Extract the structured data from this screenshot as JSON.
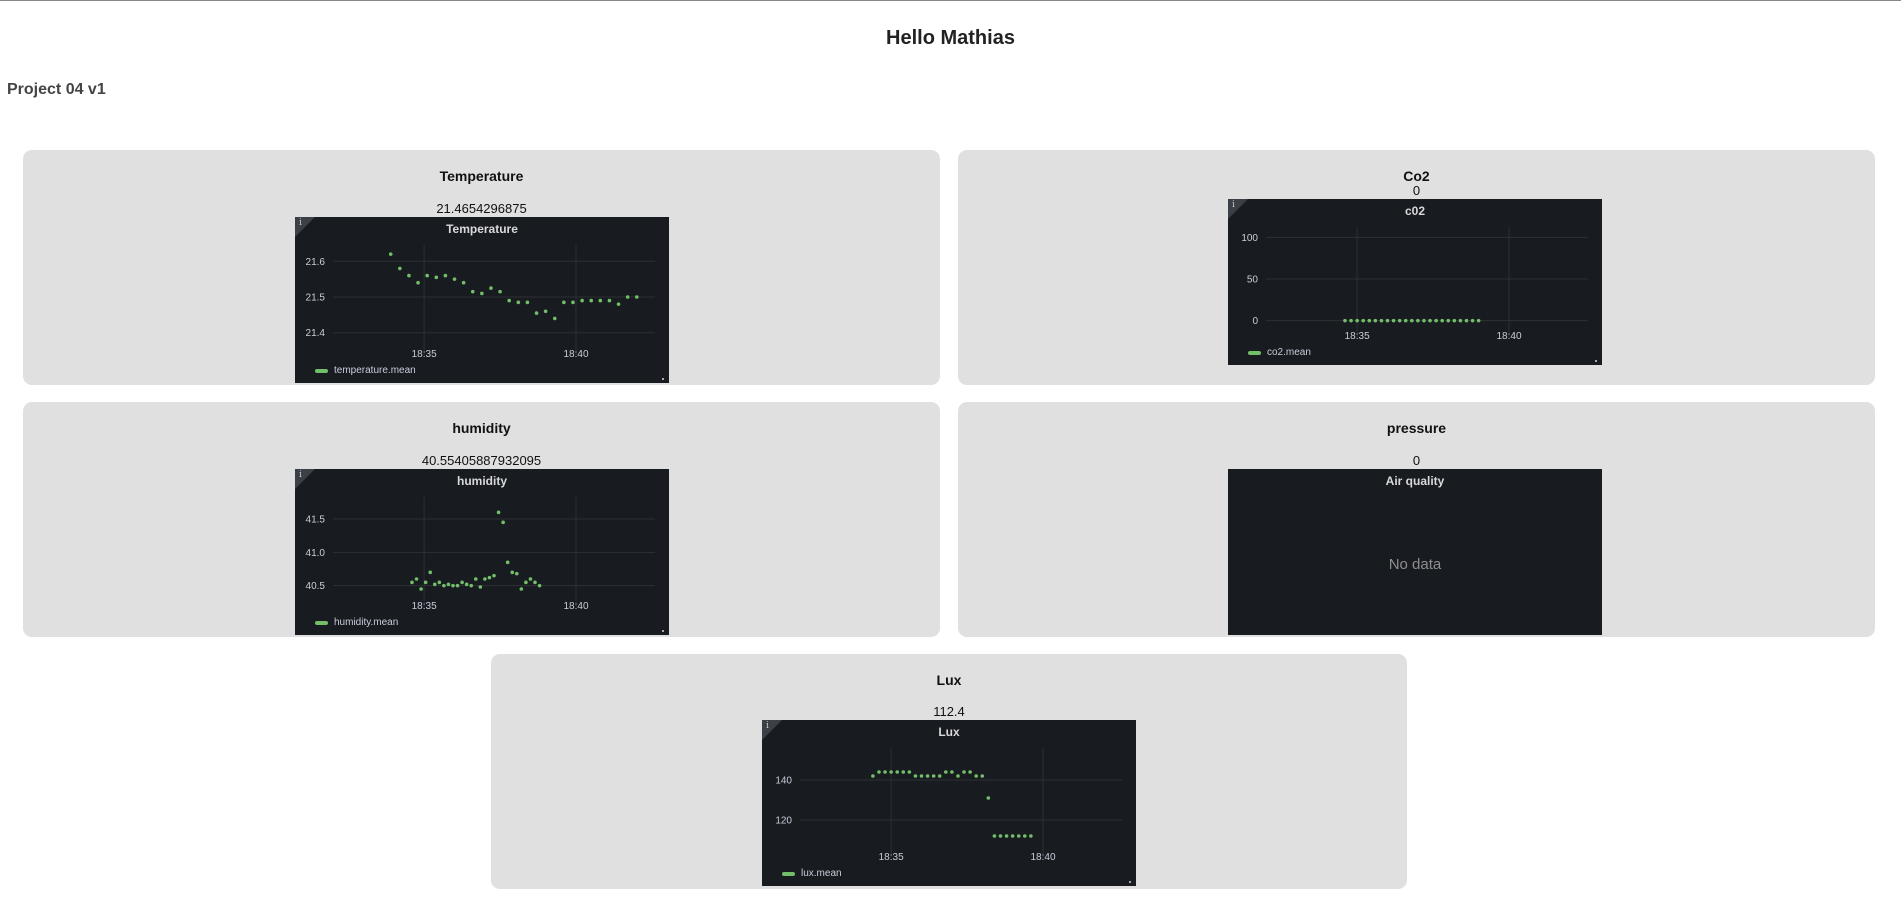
{
  "page": {
    "greeting": "Hello Mathias",
    "project": "Project 04 v1"
  },
  "colors": {
    "card_bg": "#e0e0e0",
    "panel_bg": "#181b1f",
    "series_green": "#73bf69",
    "grid": "#2c3036",
    "text_light": "#ccccdc"
  },
  "cards": {
    "temperature": {
      "title": "Temperature",
      "value": "21.4654296875",
      "panel_title": "Temperature",
      "legend": "temperature.mean",
      "info_icon": "info-icon"
    },
    "co2": {
      "title": "Co2",
      "value": "0",
      "panel_title": "c02",
      "legend": "co2.mean",
      "info_icon": "info-icon"
    },
    "humidity": {
      "title": "humidity",
      "value": "40.55405887932095",
      "panel_title": "humidity",
      "legend": "humidity.mean",
      "info_icon": "info-icon"
    },
    "pressure": {
      "title": "pressure",
      "value": "0",
      "panel_title": "Air quality",
      "no_data": "No data"
    },
    "lux": {
      "title": "Lux",
      "value": "112.4",
      "panel_title": "Lux",
      "legend": "lux.mean",
      "info_icon": "info-icon"
    }
  },
  "chart_data": [
    {
      "id": "temperature",
      "type": "scatter",
      "title": "Temperature",
      "series": [
        {
          "name": "temperature.mean",
          "x": [
            33.9,
            34.2,
            34.5,
            34.8,
            35.1,
            35.4,
            35.7,
            36.0,
            36.3,
            36.6,
            36.9,
            37.2,
            37.5,
            37.8,
            38.1,
            38.4,
            38.7,
            39.0,
            39.3,
            39.6,
            39.9,
            40.2,
            40.5,
            40.8,
            41.1,
            41.4,
            41.7,
            42.0
          ],
          "values": [
            21.62,
            21.58,
            21.56,
            21.54,
            21.56,
            21.555,
            21.56,
            21.55,
            21.54,
            21.515,
            21.51,
            21.525,
            21.515,
            21.49,
            21.485,
            21.485,
            21.455,
            21.46,
            21.44,
            21.485,
            21.485,
            21.49,
            21.49,
            21.49,
            21.49,
            21.48,
            21.5,
            21.5
          ]
        }
      ],
      "x_ticks": [
        "18:35",
        "18:40"
      ],
      "y_ticks": [
        "21.4",
        "21.5",
        "21.6"
      ],
      "ylim": [
        21.36,
        21.64
      ]
    },
    {
      "id": "co2",
      "type": "scatter",
      "title": "c02",
      "series": [
        {
          "name": "co2.mean",
          "x": [
            34.6,
            34.8,
            35.0,
            35.2,
            35.4,
            35.6,
            35.8,
            36.0,
            36.2,
            36.4,
            36.6,
            36.8,
            37.0,
            37.2,
            37.4,
            37.6,
            37.8,
            38.0,
            38.2,
            38.4,
            38.6,
            38.8,
            39.0
          ],
          "values": [
            0,
            0,
            0,
            0,
            0,
            0,
            0,
            0,
            0,
            0,
            0,
            0,
            0,
            0,
            0,
            0,
            0,
            0,
            0,
            0,
            0,
            0,
            0
          ]
        }
      ],
      "x_ticks": [
        "18:35",
        "18:40"
      ],
      "y_ticks": [
        "0",
        "50",
        "100"
      ],
      "ylim": [
        -10,
        110
      ]
    },
    {
      "id": "humidity",
      "type": "scatter",
      "title": "humidity",
      "series": [
        {
          "name": "humidity.mean",
          "x": [
            34.6,
            34.75,
            34.9,
            35.05,
            35.2,
            35.35,
            35.5,
            35.65,
            35.8,
            35.95,
            36.1,
            36.25,
            36.4,
            36.55,
            36.7,
            36.85,
            37.0,
            37.15,
            37.3,
            37.45,
            37.6,
            37.75,
            37.9,
            38.05,
            38.2,
            38.35,
            38.5,
            38.65,
            38.8
          ],
          "values": [
            40.55,
            40.6,
            40.45,
            40.55,
            40.7,
            40.52,
            40.55,
            40.5,
            40.52,
            40.5,
            40.5,
            40.55,
            40.52,
            40.5,
            40.6,
            40.48,
            40.6,
            40.62,
            40.65,
            41.6,
            41.45,
            40.85,
            40.7,
            40.68,
            40.45,
            40.55,
            40.6,
            40.55,
            40.5
          ]
        }
      ],
      "x_ticks": [
        "18:35",
        "18:40"
      ],
      "y_ticks": [
        "40.5",
        "41.0",
        "41.5"
      ],
      "ylim": [
        40.3,
        41.8
      ]
    },
    {
      "id": "lux",
      "type": "scatter",
      "title": "Lux",
      "series": [
        {
          "name": "lux.mean",
          "x": [
            34.4,
            34.6,
            34.8,
            35.0,
            35.2,
            35.4,
            35.6,
            35.8,
            36.0,
            36.2,
            36.4,
            36.6,
            36.8,
            37.0,
            37.2,
            37.4,
            37.6,
            37.8,
            38.0,
            38.2,
            38.4,
            38.6,
            38.8,
            39.0,
            39.2,
            39.4,
            39.6
          ],
          "values": [
            142,
            144,
            144,
            144,
            144,
            144,
            144,
            142,
            142,
            142,
            142,
            142,
            144,
            144,
            142,
            144,
            144,
            142,
            142,
            131,
            112,
            112,
            112,
            112,
            112,
            112,
            112
          ]
        }
      ],
      "x_ticks": [
        "18:35",
        "18:40"
      ],
      "y_ticks": [
        "120",
        "140"
      ],
      "ylim": [
        105,
        155
      ]
    }
  ]
}
